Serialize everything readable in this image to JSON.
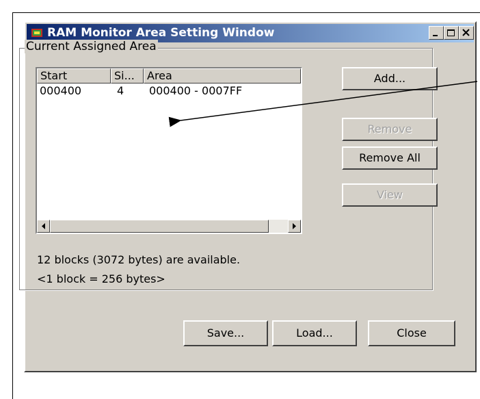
{
  "window": {
    "title": "RAM Monitor Area Setting Window",
    "titlebar_colors": [
      "#0a246a",
      "#a6caf0"
    ]
  },
  "group": {
    "label": "Current Assigned Area"
  },
  "list": {
    "columns": [
      "Start",
      "Si...",
      "Area"
    ],
    "rows": [
      {
        "start": "000400",
        "size": "4",
        "area": "000400 - 0007FF"
      }
    ]
  },
  "side_buttons": {
    "add": "Add...",
    "remove": "Remove",
    "remove_all": "Remove All",
    "view": "View"
  },
  "info": {
    "available": "12 blocks (3072 bytes) are available.",
    "block_size": "<1 block = 256 bytes>"
  },
  "bottom_buttons": {
    "save": "Save...",
    "load": "Load...",
    "close": "Close"
  }
}
